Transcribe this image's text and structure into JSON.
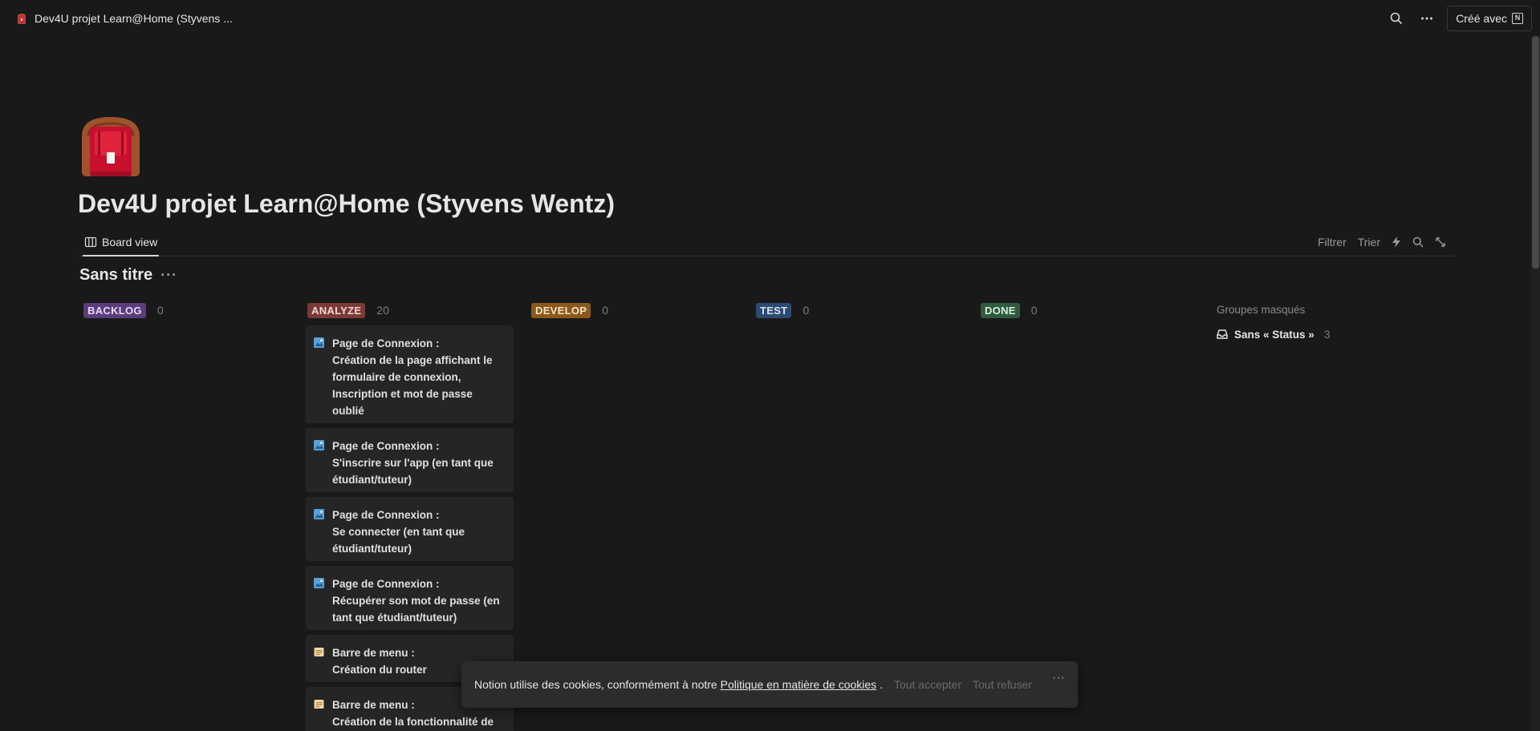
{
  "topbar": {
    "title": "Dev4U projet Learn@Home (Styvens ...",
    "created_with": "Créé avec",
    "search_icon": "search-icon",
    "more_icon": "more-horizontal-icon"
  },
  "page": {
    "icon": "backpack-icon",
    "title": "Dev4U projet Learn@Home (Styvens Wentz)"
  },
  "view": {
    "tab_label": "Board view",
    "actions": {
      "filter": "Filtrer",
      "sort": "Trier"
    }
  },
  "database": {
    "title": "Sans titre"
  },
  "columns": [
    {
      "label": "BACKLOG",
      "count": "0",
      "color": "#5a3d7a",
      "text_color": "#e8d9f5"
    },
    {
      "label": "ANALYZE",
      "count": "20",
      "color": "#7a3a37",
      "text_color": "#f3d6d3"
    },
    {
      "label": "DEVELOP",
      "count": "0",
      "color": "#8a5a1c",
      "text_color": "#f6e3c6"
    },
    {
      "label": "TEST",
      "count": "0",
      "color": "#2c4a72",
      "text_color": "#d6e4f6"
    },
    {
      "label": "DONE",
      "count": "0",
      "color": "#2f5a3e",
      "text_color": "#d3efdd"
    }
  ],
  "cards": [
    {
      "icon": "image-icon",
      "lines": [
        "Page de Connexion :",
        "Création de la page affichant le",
        "formulaire de connexion,",
        "Inscription et mot de passe",
        "oublié"
      ]
    },
    {
      "icon": "image-icon",
      "lines": [
        "Page de Connexion :",
        "S'inscrire sur l'app (en tant que",
        "étudiant/tuteur)"
      ]
    },
    {
      "icon": "image-icon",
      "lines": [
        "Page de Connexion :",
        "Se connecter (en tant que",
        "étudiant/tuteur)"
      ]
    },
    {
      "icon": "image-icon",
      "lines": [
        "Page de Connexion :",
        "Récupérer son mot de passe (en",
        "tant que étudiant/tuteur)"
      ]
    },
    {
      "icon": "menu-card-icon",
      "lines": [
        "Barre de menu :",
        "Création du router"
      ]
    },
    {
      "icon": "menu-card-icon",
      "lines": [
        "Barre de menu :",
        "Création de la fonctionnalité  de"
      ]
    }
  ],
  "hidden_groups": {
    "label": "Groupes masqués",
    "item_label": "Sans « Status »",
    "item_count": "3"
  },
  "cookie": {
    "text": "Notion utilise des cookies, conformément à notre",
    "link": "Politique en matière de cookies",
    "period": ".",
    "accept": "Tout accepter",
    "refuse": "Tout refuser"
  }
}
